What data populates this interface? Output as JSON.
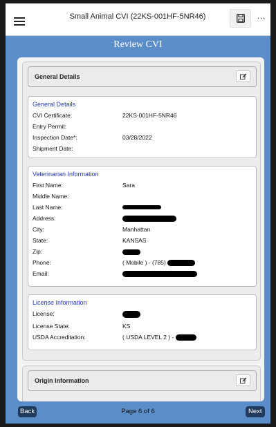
{
  "header": {
    "title": "Small Animal CVI (22KS-001HF-5NR46)",
    "more_label": "..."
  },
  "page_heading": "Review CVI",
  "general_section": {
    "header_title": "General Details",
    "card_title": "General Details",
    "rows": [
      {
        "label": "CVI Certificate:",
        "value": "22KS-001HF-5NR46"
      },
      {
        "label": "Entry Permit:",
        "value": ""
      },
      {
        "label": "Inspection Date*:",
        "value": "03/28/2022"
      },
      {
        "label": "Shipment Date:",
        "value": ""
      }
    ]
  },
  "vet_section": {
    "card_title": "Veterinarian Information",
    "rows": [
      {
        "label": "First Name:",
        "value": "Sara"
      },
      {
        "label": "Middle Name:",
        "value": ""
      },
      {
        "label": "Last Name:",
        "value": ""
      },
      {
        "label": "Address:",
        "value": ""
      },
      {
        "label": "City:",
        "value": "Manhattan"
      },
      {
        "label": "State:",
        "value": "KANSAS"
      },
      {
        "label": "Zip:",
        "value": ""
      },
      {
        "label": "Phone:",
        "value": "( Mobile ) - (785)"
      },
      {
        "label": "Email:",
        "value": ""
      }
    ]
  },
  "license_section": {
    "card_title": "License Information",
    "rows": [
      {
        "label": "License:",
        "value": ""
      },
      {
        "label": "License State:",
        "value": "KS"
      },
      {
        "label": "USDA Accreditation:",
        "value": "( USDA LEVEL 2 ) -"
      }
    ]
  },
  "origin_section": {
    "header_title": "Origin Information"
  },
  "footer": {
    "back_label": "Back",
    "page_indicator": "Page 6 of 6",
    "next_label": "Next"
  }
}
